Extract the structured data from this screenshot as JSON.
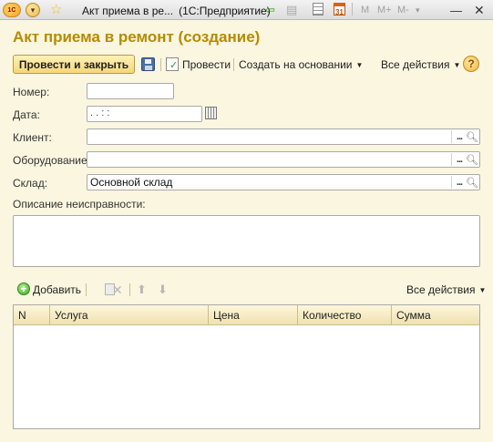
{
  "titlebar": {
    "doc_title": "Акт приема в ре...",
    "app_title": "(1С:Предприятие)",
    "logo_text": "1С",
    "calendar_day": "31",
    "mem_buttons": [
      "M",
      "M+",
      "M-"
    ],
    "icons": [
      "app-logo-icon",
      "menu-dropdown-icon",
      "favorite-star-icon",
      "back-arrow-icon",
      "document-icon",
      "calculator-icon",
      "calendar-icon",
      "minimize-icon",
      "close-icon"
    ]
  },
  "form": {
    "heading": "Акт приема в ремонт (создание)",
    "commands": {
      "post_and_close": "Провести и закрыть",
      "post": "Провести",
      "create_based_on": "Создать на основании",
      "all_actions": "Все действия",
      "help": "?"
    },
    "fields": {
      "number_label": "Номер:",
      "number_value": "",
      "date_label": "Дата:",
      "date_value": " .  .       :  :",
      "client_label": "Клиент:",
      "client_value": "",
      "equipment_label": "Оборудование:",
      "equipment_value": "",
      "warehouse_label": "Склад:",
      "warehouse_value": "Основной склад",
      "fault_description_label": "Описание неисправности:",
      "fault_description_value": ""
    }
  },
  "table": {
    "toolbar": {
      "add": "Добавить",
      "all_actions": "Все действия"
    },
    "columns": [
      "N",
      "Услуга",
      "Цена",
      "Количество",
      "Сумма"
    ],
    "rows": []
  },
  "colors": {
    "background": "#fbf6df",
    "heading": "#b58c00",
    "primary_button": "#f5d778"
  }
}
